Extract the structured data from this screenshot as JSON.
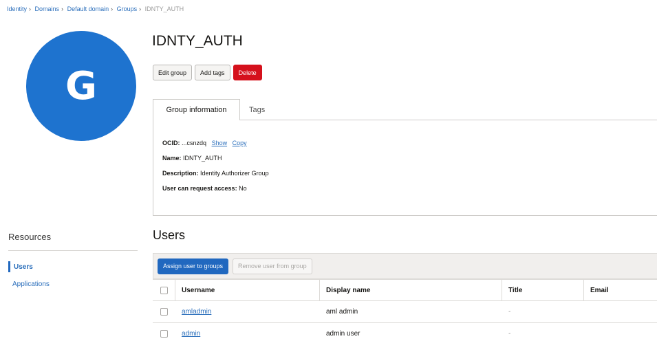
{
  "breadcrumb": {
    "items": [
      "Identity",
      "Domains",
      "Default domain",
      "Groups"
    ],
    "current": "IDNTY_AUTH"
  },
  "avatar": {
    "letter": "G",
    "color": "#1e73cf"
  },
  "page": {
    "title": "IDNTY_AUTH"
  },
  "actions": {
    "edit": "Edit group",
    "add_tags": "Add tags",
    "delete": "Delete"
  },
  "tabs": {
    "group_information": "Group information",
    "tags": "Tags"
  },
  "info": {
    "ocid_label": "OCID:",
    "ocid_value": "...csnzdq",
    "show": "Show",
    "copy": "Copy",
    "name_label": "Name:",
    "name_value": "IDNTY_AUTH",
    "description_label": "Description:",
    "description_value": "Identity Authorizer Group",
    "request_label": "User can request access:",
    "request_value": "No"
  },
  "resources": {
    "title": "Resources",
    "items": [
      {
        "label": "Users",
        "active": true
      },
      {
        "label": "Applications",
        "active": false
      }
    ]
  },
  "users": {
    "title": "Users",
    "assign": "Assign user to groups",
    "remove": "Remove user from group",
    "columns": [
      "Username",
      "Display name",
      "Title",
      "Email"
    ],
    "rows": [
      {
        "username": "amladmin",
        "display_name": "aml admin",
        "title": "-",
        "email": ""
      },
      {
        "username": "admin",
        "display_name": "admin user",
        "title": "-",
        "email": ""
      }
    ]
  },
  "colors": {
    "accent": "#2168bf",
    "danger": "#d5111c",
    "link": "#2a6ebb"
  }
}
